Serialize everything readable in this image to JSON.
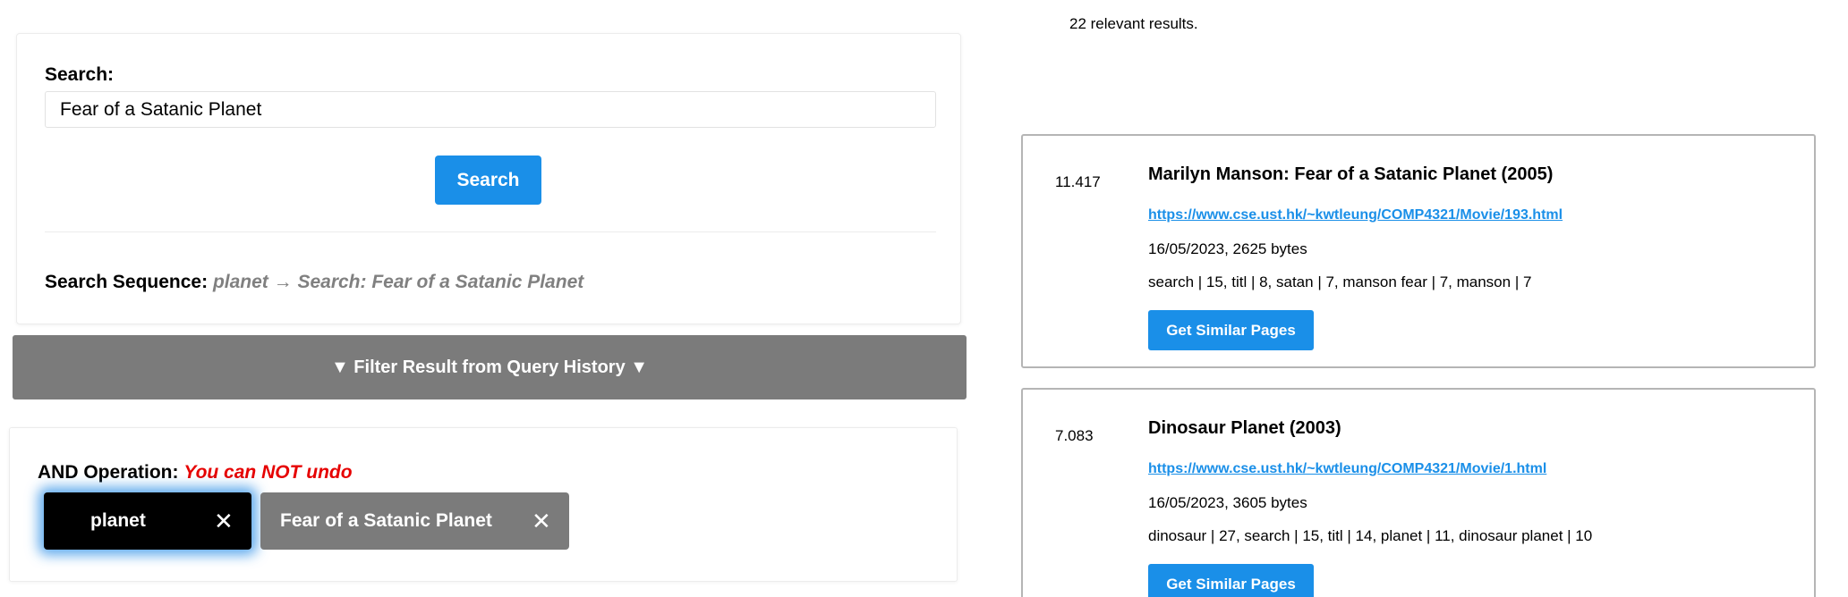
{
  "search": {
    "label": "Search:",
    "query": "Fear of a Satanic Planet",
    "button_label": "Search",
    "sequence_label": "Search Sequence:",
    "sequence_value": "planet → Search: Fear of a Satanic Planet"
  },
  "filter": {
    "label": "▼ Filter Result from Query History ▼"
  },
  "and_operation": {
    "label": "AND Operation:",
    "warning": "You can NOT undo",
    "chips": [
      {
        "label": "planet",
        "close": "✕",
        "active": true
      },
      {
        "label": "Fear of a Satanic Planet",
        "close": "✕",
        "active": false
      }
    ]
  },
  "results": {
    "count_text": "22 relevant results.",
    "items": [
      {
        "score": "11.417",
        "title": "Marilyn Manson: Fear of a Satanic Planet (2005)",
        "url": "https://www.cse.ust.hk/~kwtleung/COMP4321/Movie/193.html",
        "date_size": "16/05/2023, 2625 bytes",
        "keywords": "search | 15, titl | 8, satan | 7, manson fear | 7, manson | 7",
        "button_label": "Get Similar Pages"
      },
      {
        "score": "7.083",
        "title": "Dinosaur Planet (2003)",
        "url": "https://www.cse.ust.hk/~kwtleung/COMP4321/Movie/1.html",
        "date_size": "16/05/2023, 3605 bytes",
        "keywords": "dinosaur | 27, search | 15, titl | 14, planet | 11, dinosaur planet | 10",
        "button_label": "Get Similar Pages"
      }
    ]
  },
  "colors": {
    "primary": "#1a8fe8",
    "filter_bar": "#7b7b7b",
    "warning": "#e60000",
    "sequence": "#808080",
    "active_chip": "#000000"
  }
}
